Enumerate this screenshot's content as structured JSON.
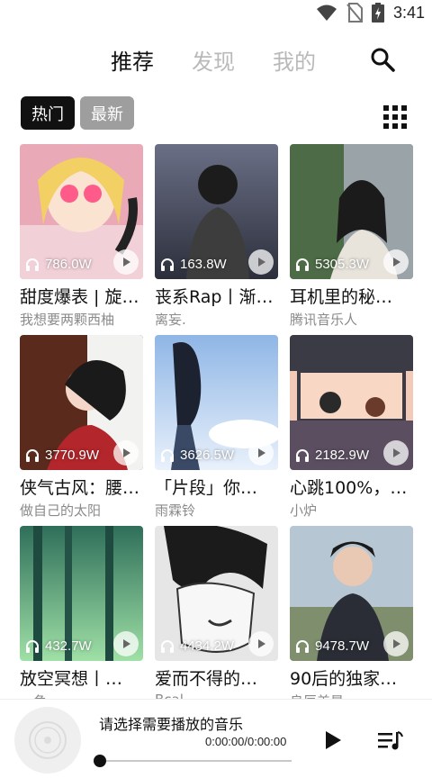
{
  "status_bar": {
    "time": "3:41",
    "icons": [
      "wifi-icon",
      "no-sim-icon",
      "battery-charging-icon"
    ]
  },
  "tabs": [
    {
      "label": "推荐",
      "active": true
    },
    {
      "label": "发现",
      "active": false
    },
    {
      "label": "我的",
      "active": false
    }
  ],
  "filters": {
    "hot": "热门",
    "new": "最新"
  },
  "playlists": [
    {
      "title": "甜度爆表 | 旋…",
      "author": "我想要两颗西柚",
      "plays": "786.0W"
    },
    {
      "title": "丧系Rap丨渐…",
      "author": "离妄.",
      "plays": "163.8W"
    },
    {
      "title": "耳机里的秘…",
      "author": "腾讯音乐人",
      "plays": "5305.3W"
    },
    {
      "title": "侠气古风：腰…",
      "author": "做自己的太阳",
      "plays": "3770.9W"
    },
    {
      "title": "「片段」你…",
      "author": "雨霖铃",
      "plays": "3626.5W"
    },
    {
      "title": "心跳100%，…",
      "author": "小炉",
      "plays": "2182.9W"
    },
    {
      "title": "放空冥想丨…",
      "author": "一角",
      "plays": "432.7W"
    },
    {
      "title": "爱而不得的…",
      "author": "Bcal",
      "plays": "4434.2W"
    },
    {
      "title": "90后的独家…",
      "author": "良辰美景",
      "plays": "9478.7W"
    }
  ],
  "player": {
    "title": "请选择需要播放的音乐",
    "time": "0:00:00/0:00:00",
    "progress": 0
  }
}
